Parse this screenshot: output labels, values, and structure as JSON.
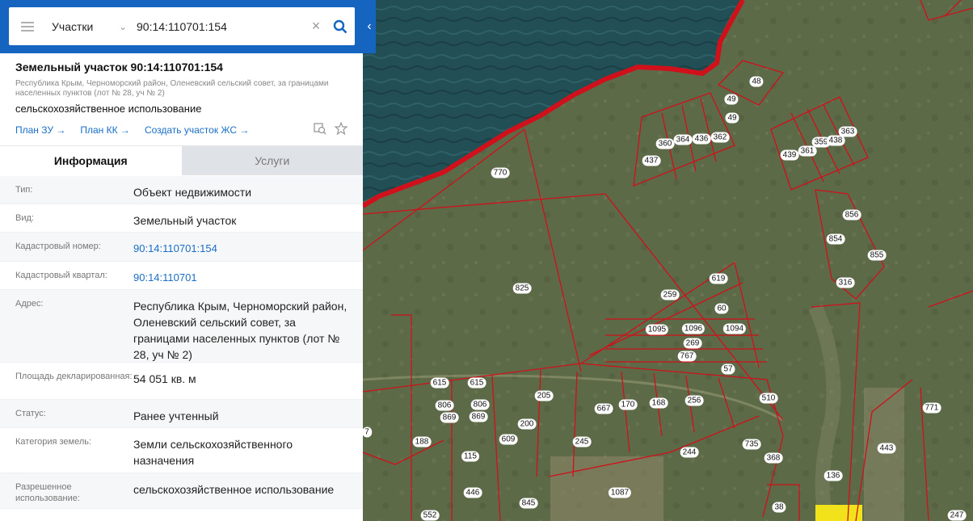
{
  "search": {
    "layer": "Участки",
    "query": "90:14:110701:154"
  },
  "object": {
    "title": "Земельный участок 90:14:110701:154",
    "address": "Республика Крым, Черноморский район, Оленевский сельский совет, за границами населенных пунктов (лот № 28, уч № 2)",
    "use": "сельскохозяйственное использование",
    "links": [
      "План ЗУ",
      "План КК",
      "Создать участок ЖС"
    ]
  },
  "tabs": [
    "Информация",
    "Услуги"
  ],
  "info": [
    {
      "label": "Тип:",
      "value": "Объект недвижимости",
      "link": false
    },
    {
      "label": "Вид:",
      "value": "Земельный участок",
      "link": false
    },
    {
      "label": "Кадастровый номер:",
      "value": "90:14:110701:154",
      "link": true
    },
    {
      "label": "Кадастровый квартал:",
      "value": "90:14:110701",
      "link": true
    },
    {
      "label": "Адрес:",
      "value": "Республика Крым, Черноморский район, Оленевский сельский совет, за границами населенных пунктов (лот № 28, уч № 2)",
      "link": false
    },
    {
      "label": "Площадь декларированная:",
      "value": "54 051 кв. м",
      "link": false
    },
    {
      "label": "Статус:",
      "value": "Ранее учтенный",
      "link": false
    },
    {
      "label": "Категория земель:",
      "value": "Земли сельскохозяйственного назначения",
      "link": false
    },
    {
      "label": "Разрешенное использование:",
      "value": "сельскохозяйственное использование",
      "link": false
    }
  ],
  "map": {
    "colors": {
      "sea": "#1f4a4e",
      "land": "#5f6b4a",
      "boundary": "#d0101a",
      "highlight": "#f2e21b"
    },
    "plot_labels": [
      "48",
      "49",
      "49",
      "360",
      "364",
      "436",
      "362",
      "437",
      "770",
      "439",
      "361",
      "359",
      "438",
      "363",
      "856",
      "854",
      "855",
      "316",
      "825",
      "619",
      "259",
      "60",
      "1095",
      "1096",
      "1094",
      "269",
      "767",
      "57",
      "615",
      "615",
      "806",
      "806",
      "869",
      "869",
      "205",
      "667",
      "170",
      "168",
      "256",
      "510",
      "188",
      "609",
      "200",
      "245",
      "244",
      "735",
      "368",
      "115",
      "446",
      "1087",
      "443",
      "771",
      "136",
      "845",
      "552",
      "38",
      "247",
      "7"
    ]
  }
}
